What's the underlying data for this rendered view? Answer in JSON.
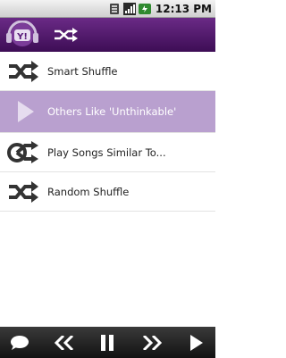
{
  "status_bar": {
    "time": "12:13 PM"
  },
  "header": {
    "logo": "yahoo-music-logo",
    "icon": "shuffle-icon"
  },
  "list": {
    "items": [
      {
        "label": "Smart Shuffle",
        "icon": "shuffle-icon"
      },
      {
        "label": "Others Like 'Unthinkable'",
        "icon": "play-icon",
        "selected": true
      },
      {
        "label": "Play Songs Similar To...",
        "icon": "similar-icon"
      },
      {
        "label": "Random Shuffle",
        "icon": "random-icon"
      }
    ]
  },
  "bottom_bar": {
    "icons": [
      "chat-icon",
      "rewind-icon",
      "pause-icon",
      "fast-forward-icon",
      "play-icon"
    ]
  },
  "colors": {
    "header": "#4d1a6b",
    "selected_row": "#b9a0cf",
    "bottom_bar": "#222222"
  }
}
